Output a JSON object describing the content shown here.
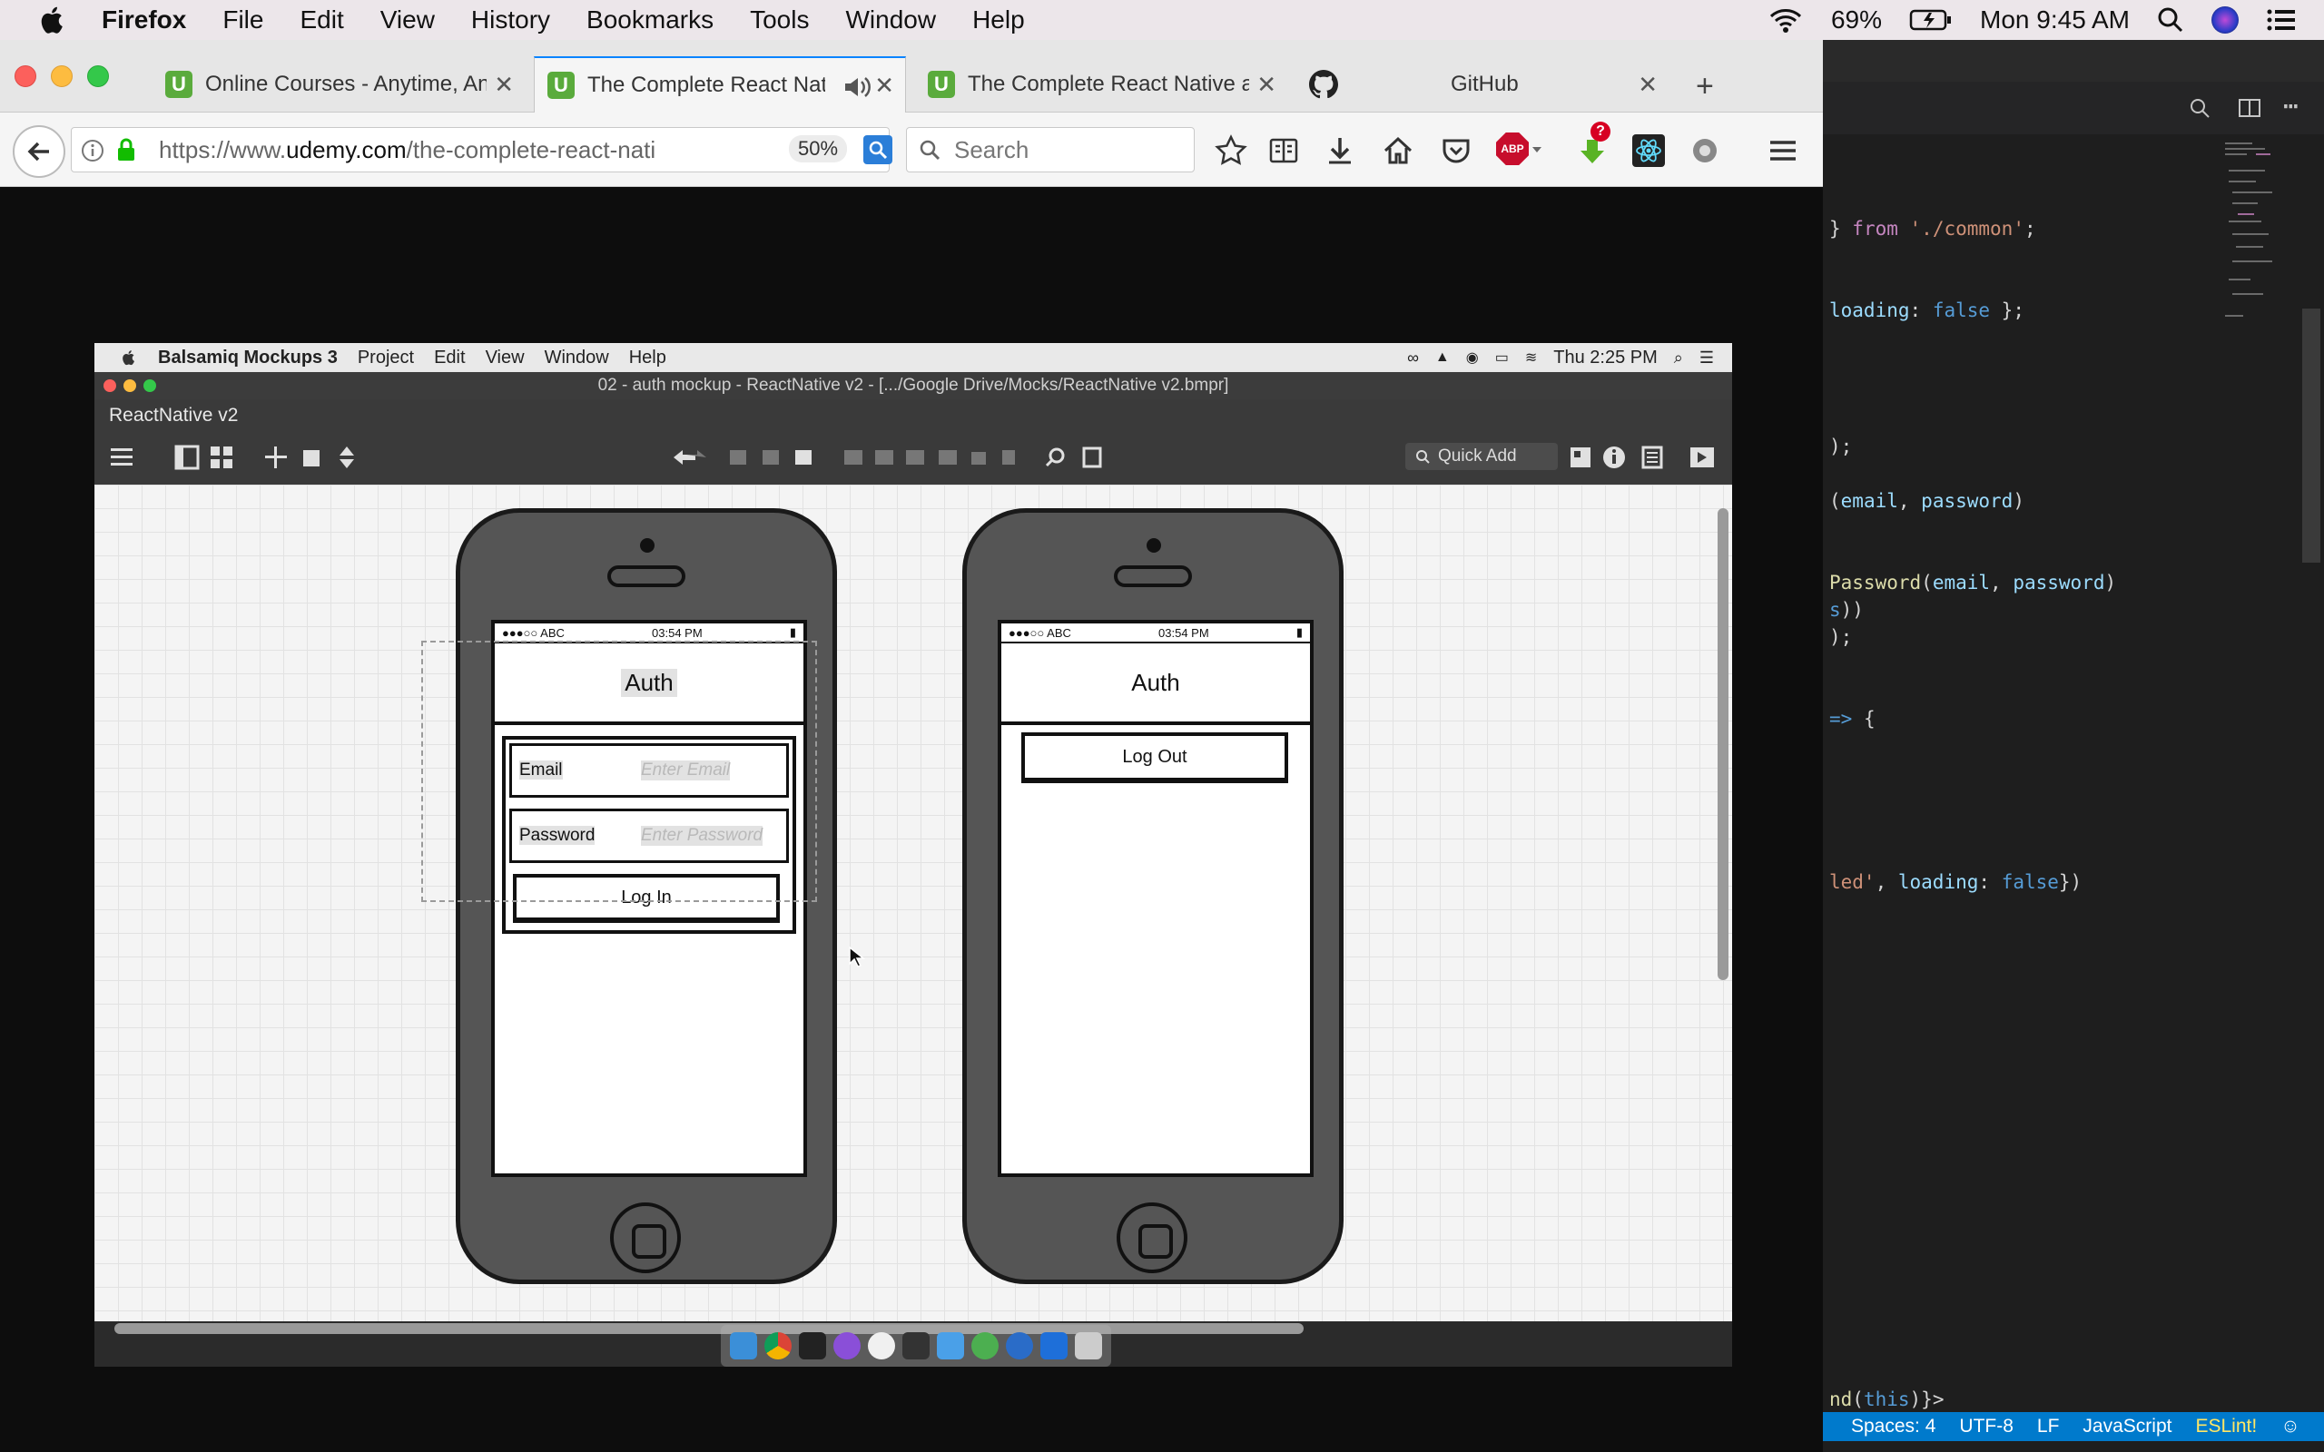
{
  "mac_menubar": {
    "app": "Firefox",
    "items": [
      "File",
      "Edit",
      "View",
      "History",
      "Bookmarks",
      "Tools",
      "Window",
      "Help"
    ],
    "battery": "69%",
    "clock": "Mon 9:45 AM"
  },
  "firefox": {
    "tabs": [
      {
        "label": "Online Courses - Anytime, Any"
      },
      {
        "label": "The Complete React Nativ"
      },
      {
        "label": "The Complete React Native a"
      },
      {
        "label": "GitHub"
      }
    ],
    "url_prefix": "https://www.",
    "url_domain": "udemy.com",
    "url_path": "/the-complete-react-nati",
    "zoom": "50%",
    "search_placeholder": "Search",
    "abp_badge": "ABP"
  },
  "balsamiq": {
    "menubar": {
      "app": "Balsamiq Mockups 3",
      "items": [
        "Project",
        "Edit",
        "View",
        "Window",
        "Help"
      ],
      "clock": "Thu 2:25 PM"
    },
    "window_title": "02 - auth mockup - ReactNative v2 - [.../Google Drive/Mocks/ReactNative v2.bmpr]",
    "project_name": "ReactNative v2",
    "quick_add": "Quick Add",
    "phones": [
      {
        "status_carrier": "●●●○○ ABC",
        "status_time": "03:54 PM",
        "header": "Auth",
        "email_label": "Email",
        "email_placeholder": "Enter Email",
        "password_label": "Password",
        "password_placeholder": "Enter Password",
        "button": "Log In"
      },
      {
        "status_carrier": "●●●○○ ABC",
        "status_time": "03:54 PM",
        "header": "Auth",
        "button": "Log Out"
      }
    ]
  },
  "vscode": {
    "status": {
      "spaces": "Spaces: 4",
      "encoding": "UTF-8",
      "eol": "LF",
      "language": "JavaScript",
      "linter": "ESLint!"
    }
  }
}
